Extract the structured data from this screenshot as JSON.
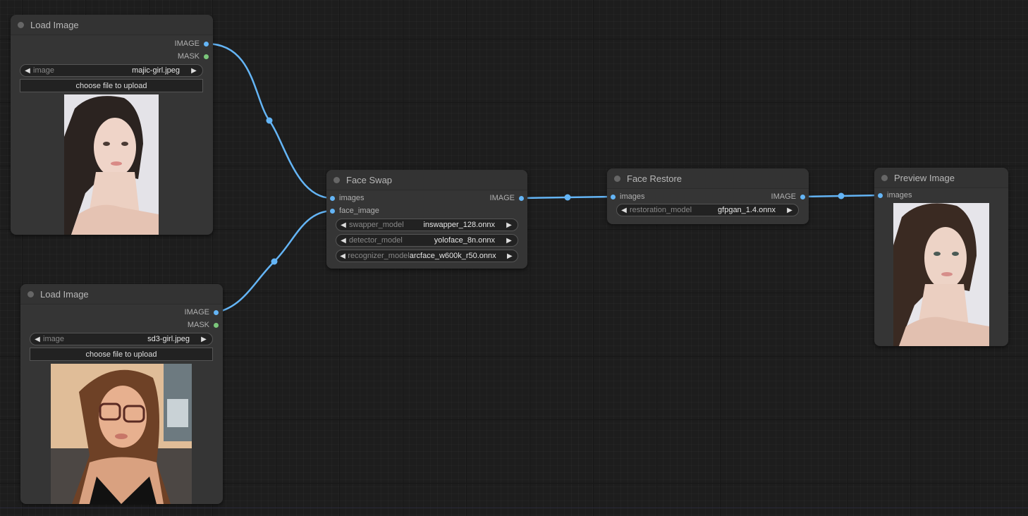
{
  "canvas": {
    "link_color": "#64b5f6",
    "image_slot_color": "#64b5f6",
    "mask_slot_color": "#7bc77b"
  },
  "nodes": {
    "load_image_1": {
      "title": "Load Image",
      "outputs": [
        "IMAGE",
        "MASK"
      ],
      "widget": {
        "label": "image",
        "value": "majic-girl.jpeg"
      },
      "upload_label": "choose file to upload",
      "preview": "portrait of young woman with dark hair, white background"
    },
    "load_image_2": {
      "title": "Load Image",
      "outputs": [
        "IMAGE",
        "MASK"
      ],
      "widget": {
        "label": "image",
        "value": "sd3-girl.jpeg"
      },
      "upload_label": "choose file to upload",
      "preview": "selfie of young woman with glasses and wavy hair, sunlit wall"
    },
    "face_swap": {
      "title": "Face Swap",
      "inputs": [
        "images",
        "face_image"
      ],
      "outputs": [
        "IMAGE"
      ],
      "widgets": [
        {
          "label": "swapper_model",
          "value": "inswapper_128.onnx"
        },
        {
          "label": "detector_model",
          "value": "yoloface_8n.onnx"
        },
        {
          "label": "recognizer_model",
          "value": "arcface_w600k_r50.onnx"
        }
      ]
    },
    "face_restore": {
      "title": "Face Restore",
      "inputs": [
        "images"
      ],
      "outputs": [
        "IMAGE"
      ],
      "widgets": [
        {
          "label": "restoration_model",
          "value": "gfpgan_1.4.onnx"
        }
      ]
    },
    "preview_image": {
      "title": "Preview Image",
      "inputs": [
        "images"
      ],
      "preview": "portrait of young woman with dark hair, white background"
    }
  },
  "links": [
    {
      "from": "load_image_1.IMAGE",
      "to": "face_swap.images"
    },
    {
      "from": "load_image_2.IMAGE",
      "to": "face_swap.face_image"
    },
    {
      "from": "face_swap.IMAGE",
      "to": "face_restore.images"
    },
    {
      "from": "face_restore.IMAGE",
      "to": "preview_image.images"
    }
  ]
}
